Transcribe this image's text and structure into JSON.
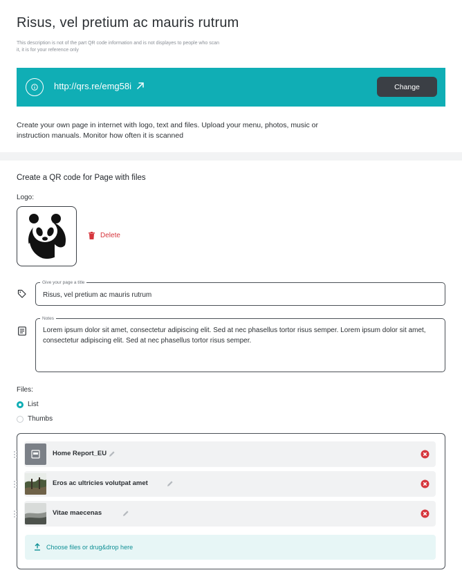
{
  "header": {
    "title": "Risus, vel pretium ac mauris rutrum",
    "description": "This description is not of the part QR code information and is not displayes to people who scan it, it is for your reference only"
  },
  "url_bar": {
    "url": "http://qrs.re/emg58i",
    "change_label": "Change"
  },
  "intro": "Create your own page in internet with logo, text and files. Upload your menu, photos, music or instruction manuals. Monitor how often it is scanned",
  "form": {
    "section_title": "Create a QR code for Page with files",
    "logo_label": "Logo:",
    "delete_label": "Delete",
    "title_field": {
      "legend": "Give your page a title",
      "value": "Risus, vel pretium ac mauris rutrum"
    },
    "notes_field": {
      "legend": "Notes",
      "value": "Lorem ipsum dolor sit amet, consectetur adipiscing elit. Sed at nec phasellus tortor risus semper. Lorem ipsum dolor sit amet, consectetur adipiscing elit. Sed at nec phasellus tortor risus semper."
    },
    "files_label": "Files:",
    "view_options": [
      {
        "label": "List",
        "selected": true
      },
      {
        "label": "Thumbs",
        "selected": false
      }
    ],
    "files": [
      {
        "name": "Home Report_EU",
        "thumb": "pdf-file-icon"
      },
      {
        "name": "Eros ac ultricies volutpat amet",
        "thumb": "forest-photo"
      },
      {
        "name": "Vitae maecenas",
        "thumb": "misty-landscape-photo"
      }
    ],
    "upload_label": "Choose files or drug&drop here"
  },
  "colors": {
    "accent": "#10aeb5",
    "danger": "#d6363d",
    "button_dark": "#3b3f45",
    "upload_bg": "#e7f6f6"
  }
}
